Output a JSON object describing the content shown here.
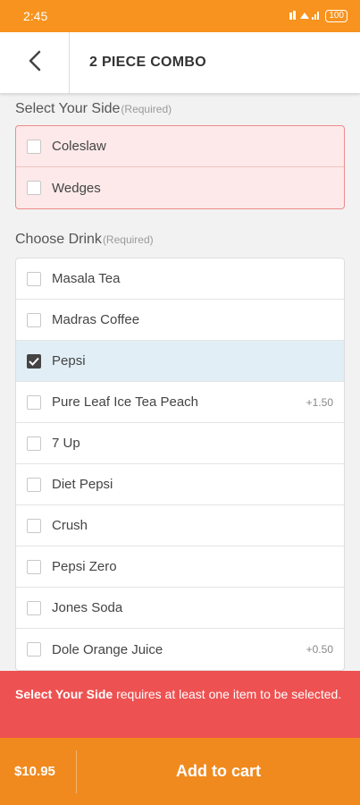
{
  "status_bar": {
    "time": "2:45",
    "battery": "100"
  },
  "header": {
    "title": "2 PIECE COMBO"
  },
  "sections": {
    "side": {
      "title": "Select Your Side",
      "required": "(Required)",
      "options": [
        {
          "label": "Coleslaw",
          "checked": false
        },
        {
          "label": "Wedges",
          "checked": false
        }
      ]
    },
    "drink": {
      "title": "Choose Drink",
      "required": "(Required)",
      "options": [
        {
          "label": "Masala Tea",
          "price": "",
          "checked": false
        },
        {
          "label": "Madras Coffee",
          "price": "",
          "checked": false
        },
        {
          "label": "Pepsi",
          "price": "",
          "checked": true
        },
        {
          "label": "Pure Leaf Ice Tea Peach",
          "price": "+1.50",
          "checked": false
        },
        {
          "label": "7 Up",
          "price": "",
          "checked": false
        },
        {
          "label": "Diet Pepsi",
          "price": "",
          "checked": false
        },
        {
          "label": "Crush",
          "price": "",
          "checked": false
        },
        {
          "label": "Pepsi Zero",
          "price": "",
          "checked": false
        },
        {
          "label": "Jones Soda",
          "price": "",
          "checked": false
        },
        {
          "label": "Dole Orange Juice",
          "price": "+0.50",
          "checked": false
        }
      ]
    }
  },
  "error": {
    "bold": "Select Your Side",
    "text": " requires at least one item to be selected."
  },
  "footer": {
    "price": "$10.95",
    "button": "Add to cart"
  },
  "colors": {
    "brand": "#f7931e",
    "error": "#ee5151",
    "selected_row": "#e1eef5"
  }
}
